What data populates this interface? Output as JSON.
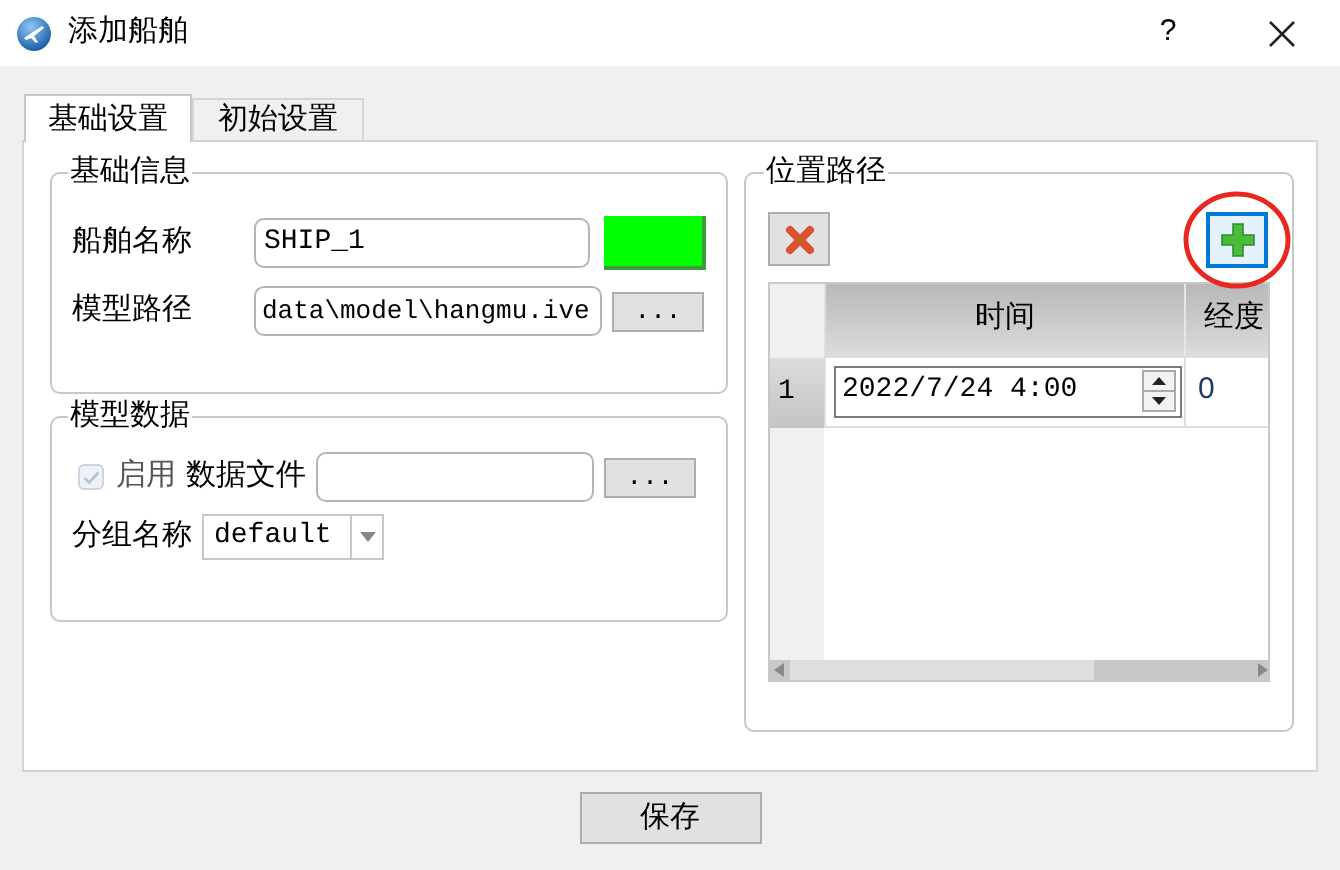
{
  "window": {
    "title": "添加船舶",
    "help": "?"
  },
  "tabs": [
    {
      "label": "基础设置",
      "selected": true
    },
    {
      "label": "初始设置",
      "selected": false
    }
  ],
  "basic_info": {
    "title": "基础信息",
    "ship_name_label": "船舶名称",
    "ship_name": "SHIP_1",
    "color": "#00ff00",
    "model_path_label": "模型路径",
    "model_path": "data\\model\\hangmu.ive",
    "browse": "..."
  },
  "model_data": {
    "title": "模型数据",
    "enable": {
      "label": "启用",
      "checked": true,
      "disabled": true
    },
    "data_file_label": "数据文件",
    "browse": "...",
    "group_label": "分组名称",
    "group": "default"
  },
  "position_path": {
    "title": "位置路径",
    "table": {
      "columns": [
        "时间",
        "经度"
      ],
      "rows": [
        {
          "header": "1",
          "cells": [
            "2022/7/24 4:00",
            "0"
          ]
        }
      ]
    }
  },
  "save": "保存"
}
